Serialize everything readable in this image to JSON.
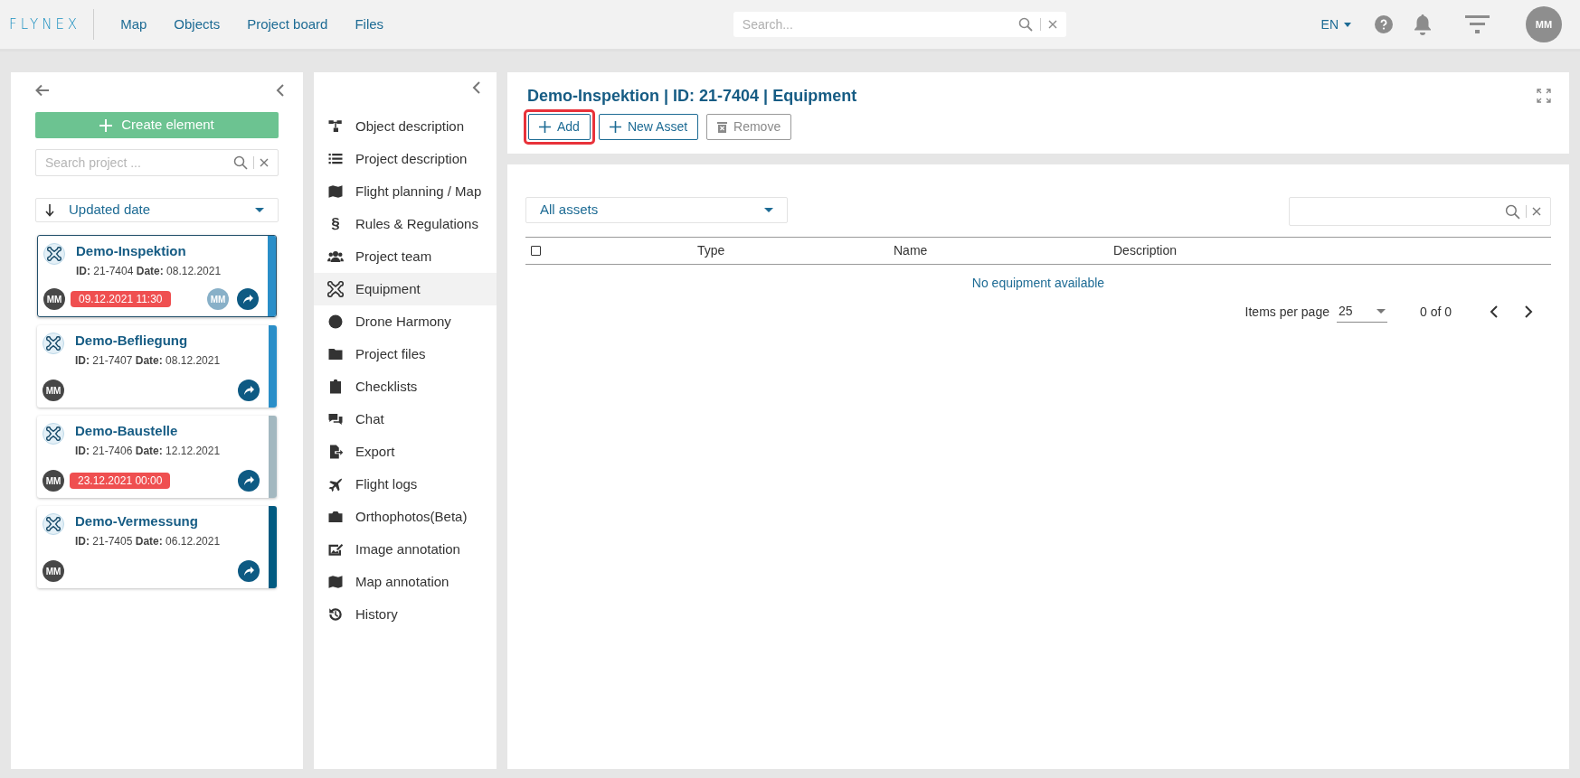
{
  "topbar": {
    "logo": "FLYNEX",
    "nav": [
      {
        "label": "Map"
      },
      {
        "label": "Objects"
      },
      {
        "label": "Project board"
      },
      {
        "label": "Files"
      }
    ],
    "search": {
      "placeholder": "Search..."
    },
    "language": "EN",
    "avatar": "MM"
  },
  "projects_panel": {
    "create_button": "Create element",
    "search": {
      "placeholder": "Search project ..."
    },
    "sort": "Updated date",
    "cards": [
      {
        "title": "Demo-Inspektion",
        "id_label": "ID:",
        "id": "21-7404",
        "date_label": "Date:",
        "date": "08.12.2021",
        "owner": "MM",
        "deadline": "09.12.2021 11:30",
        "assignee": "MM",
        "selected": true,
        "color": "#2a8ec8"
      },
      {
        "title": "Demo-Befliegung",
        "id_label": "ID:",
        "id": "21-7407",
        "date_label": "Date:",
        "date": "08.12.2021",
        "owner": "MM",
        "selected": false,
        "color": "#2a8ec8"
      },
      {
        "title": "Demo-Baustelle",
        "id_label": "ID:",
        "id": "21-7406",
        "date_label": "Date:",
        "date": "12.12.2021",
        "owner": "MM",
        "deadline": "23.12.2021 00:00",
        "selected": false,
        "color": "#a3b8c0"
      },
      {
        "title": "Demo-Vermessung",
        "id_label": "ID:",
        "id": "21-7405",
        "date_label": "Date:",
        "date": "06.12.2021",
        "owner": "MM",
        "selected": false,
        "color": "#005a80"
      }
    ]
  },
  "menu": [
    {
      "label": "Object description",
      "kind": "icon",
      "selected": false
    },
    {
      "label": "Project description",
      "kind": "icon",
      "selected": false
    },
    {
      "label": "Flight planning / Map",
      "kind": "icon",
      "selected": false
    },
    {
      "label": "Rules & Regulations",
      "kind": "glyph",
      "glyph": "§",
      "selected": false
    },
    {
      "label": "Project team",
      "kind": "icon",
      "selected": false
    },
    {
      "label": "Equipment",
      "kind": "icon",
      "selected": true
    },
    {
      "label": "Drone Harmony",
      "kind": "icon",
      "selected": false
    },
    {
      "label": "Project files",
      "kind": "icon",
      "selected": false
    },
    {
      "label": "Checklists",
      "kind": "icon",
      "selected": false
    },
    {
      "label": "Chat",
      "kind": "icon",
      "selected": false
    },
    {
      "label": "Export",
      "kind": "icon",
      "selected": false
    },
    {
      "label": "Flight logs",
      "kind": "icon",
      "selected": false
    },
    {
      "label": "Orthophotos(Beta)",
      "kind": "icon",
      "selected": false
    },
    {
      "label": "Image annotation",
      "kind": "icon",
      "selected": false
    },
    {
      "label": "Map annotation",
      "kind": "icon",
      "selected": false
    },
    {
      "label": "History",
      "kind": "icon",
      "selected": false
    }
  ],
  "header": {
    "title": "Demo-Inspektion | ID: 21-7404 | Equipment",
    "buttons": [
      {
        "label": "Add",
        "disabled": false,
        "highlighted": true
      },
      {
        "label": "New Asset",
        "disabled": false,
        "highlighted": false
      },
      {
        "label": "Remove",
        "disabled": true,
        "highlighted": false
      }
    ]
  },
  "table": {
    "filter": "All assets",
    "columns": [
      "Type",
      "Name",
      "Description"
    ],
    "checked": false,
    "empty_message": "No equipment available",
    "items_per_page_label": "Items per page",
    "items_per_page": "25",
    "range": "0 of 0"
  }
}
